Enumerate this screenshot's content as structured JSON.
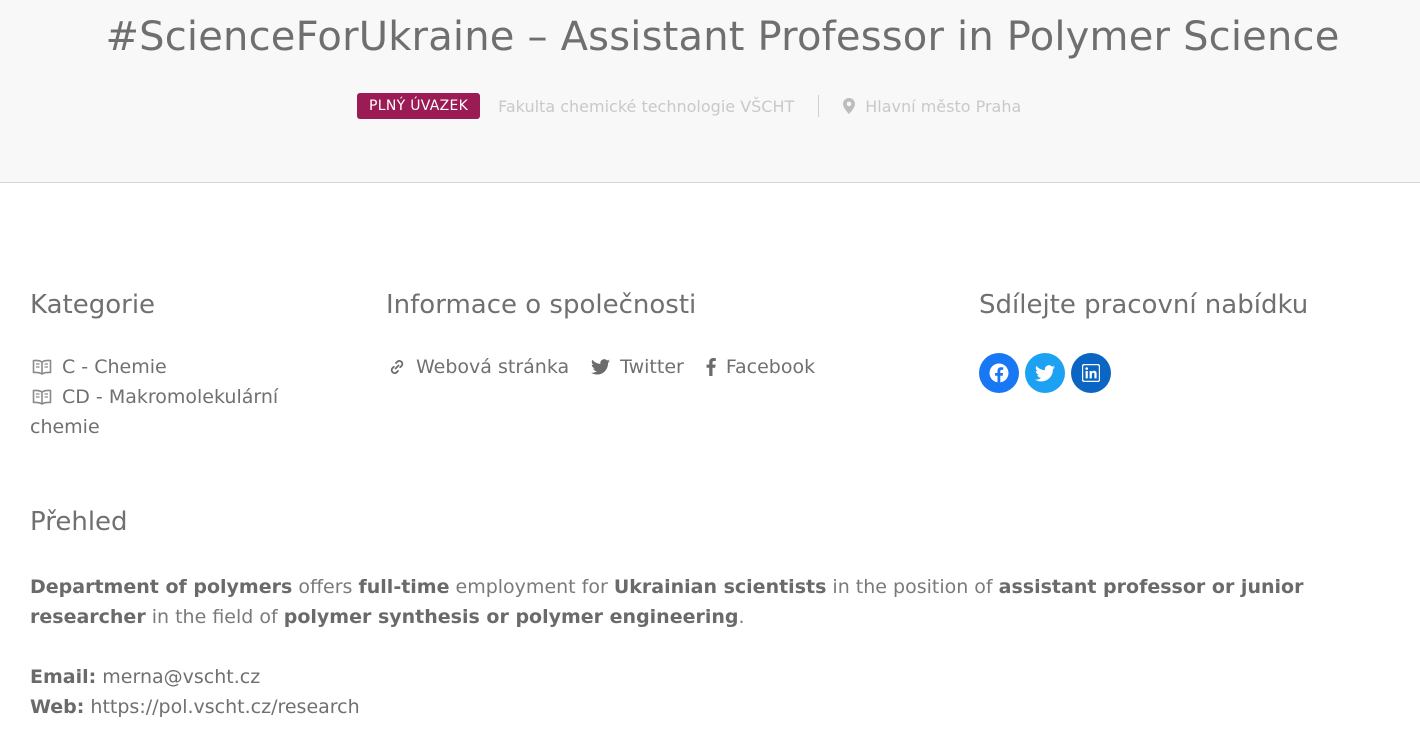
{
  "header": {
    "title": "#ScienceForUkraine – Assistant Professor in Polymer Science",
    "badge": "PLNÝ ÚVAZEK",
    "company": "Fakulta chemické technologie VŠCHT",
    "location": "Hlavní město Praha",
    "icons": [
      "map-pin-icon"
    ]
  },
  "categories": {
    "heading": "Kategorie",
    "items": [
      {
        "label": "C - Chemie",
        "icon": "book-icon"
      },
      {
        "label": "CD - Makromolekulární chemie",
        "icon": "book-icon"
      }
    ]
  },
  "company_info": {
    "heading": "Informace o společnosti",
    "links": [
      {
        "label": "Webová stránka",
        "icon": "link-icon"
      },
      {
        "label": "Twitter",
        "icon": "twitter-icon"
      },
      {
        "label": "Facebook",
        "icon": "facebook-icon"
      }
    ]
  },
  "share": {
    "heading": "Sdílejte pracovní nabídku",
    "buttons": [
      {
        "name": "facebook",
        "color": "#1877f2"
      },
      {
        "name": "twitter",
        "color": "#1da1f2"
      },
      {
        "name": "linkedin",
        "color": "#0a66c2"
      }
    ]
  },
  "overview": {
    "heading": "Přehled",
    "segments": [
      {
        "text": "Department of polymers",
        "bold": true
      },
      {
        "text": " offers ",
        "bold": false
      },
      {
        "text": "full-time",
        "bold": true
      },
      {
        "text": " employment for ",
        "bold": false
      },
      {
        "text": "Ukrainian scientists",
        "bold": true
      },
      {
        "text": " in the position of ",
        "bold": false
      },
      {
        "text": "assistant professor or junior researcher",
        "bold": true
      },
      {
        "text": " in the field of ",
        "bold": false
      },
      {
        "text": "polymer synthesis or polymer engineering",
        "bold": true
      },
      {
        "text": ".",
        "bold": false
      }
    ],
    "email_label": "Email:",
    "email_value": "merna@vscht.cz",
    "web_label": "Web:",
    "web_value": "https://pol.vscht.cz/research"
  },
  "colors": {
    "badge": "#9b1c55",
    "facebook": "#1877f2",
    "twitter": "#1da1f2",
    "linkedin": "#0a66c2"
  }
}
